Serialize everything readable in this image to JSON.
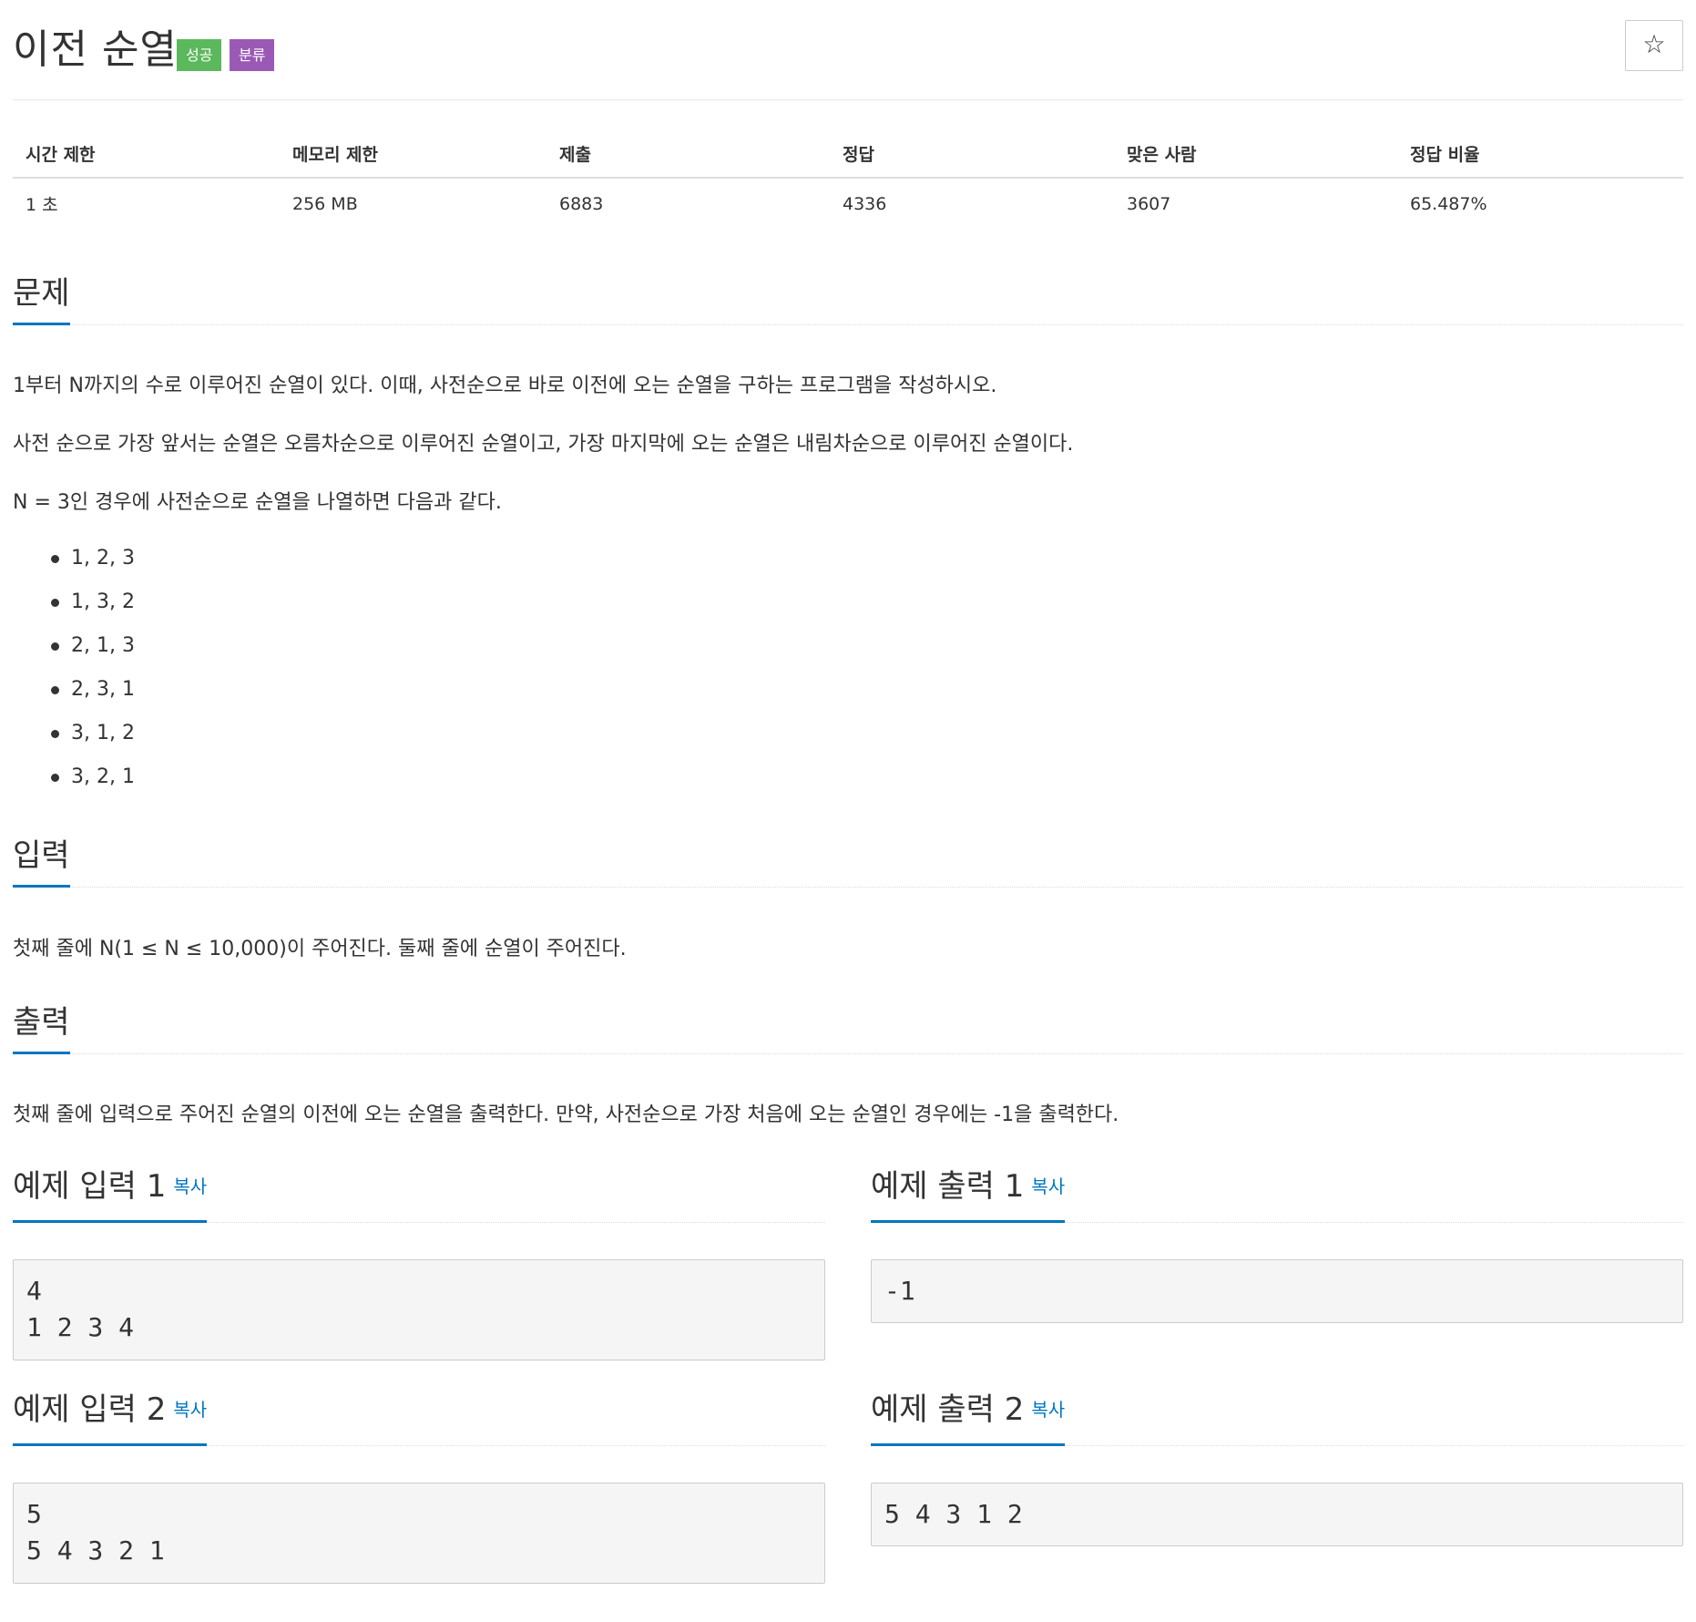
{
  "header": {
    "title": "이전 순열",
    "badge_success": "성공",
    "badge_tag": "분류",
    "star_icon": "☆"
  },
  "info_table": {
    "headers": [
      "시간 제한",
      "메모리 제한",
      "제출",
      "정답",
      "맞은 사람",
      "정답 비율"
    ],
    "values": [
      "1 초",
      "256 MB",
      "6883",
      "4336",
      "3607",
      "65.487%"
    ]
  },
  "problem": {
    "heading": "문제",
    "paragraphs": [
      "1부터 N까지의 수로 이루어진 순열이 있다. 이때, 사전순으로 바로 이전에 오는 순열을 구하는 프로그램을 작성하시오.",
      "사전 순으로 가장 앞서는 순열은 오름차순으로 이루어진 순열이고, 가장 마지막에 오는 순열은 내림차순으로 이루어진 순열이다.",
      "N = 3인 경우에 사전순으로 순열을 나열하면 다음과 같다."
    ],
    "list": [
      "1, 2, 3",
      "1, 3, 2",
      "2, 1, 3",
      "2, 3, 1",
      "3, 1, 2",
      "3, 2, 1"
    ]
  },
  "input": {
    "heading": "입력",
    "text": "첫째 줄에 N(1 ≤ N ≤ 10,000)이 주어진다. 둘째 줄에 순열이 주어진다."
  },
  "output": {
    "heading": "출력",
    "text": "첫째 줄에 입력으로 주어진 순열의 이전에 오는 순열을 출력한다. 만약, 사전순으로 가장 처음에 오는 순열인 경우에는 -1을 출력한다."
  },
  "samples": {
    "copy_label": "복사",
    "input1": {
      "heading": "예제 입력 1",
      "content": "4\n1 2 3 4"
    },
    "output1": {
      "heading": "예제 출력 1",
      "content": "-1"
    },
    "input2": {
      "heading": "예제 입력 2",
      "content": "5\n5 4 3 2 1"
    },
    "output2": {
      "heading": "예제 출력 2",
      "content": "5 4 3 1 2"
    }
  },
  "colors": {
    "accent": "#0076c0",
    "success": "#5cb85c",
    "tag": "#9b59b6"
  }
}
